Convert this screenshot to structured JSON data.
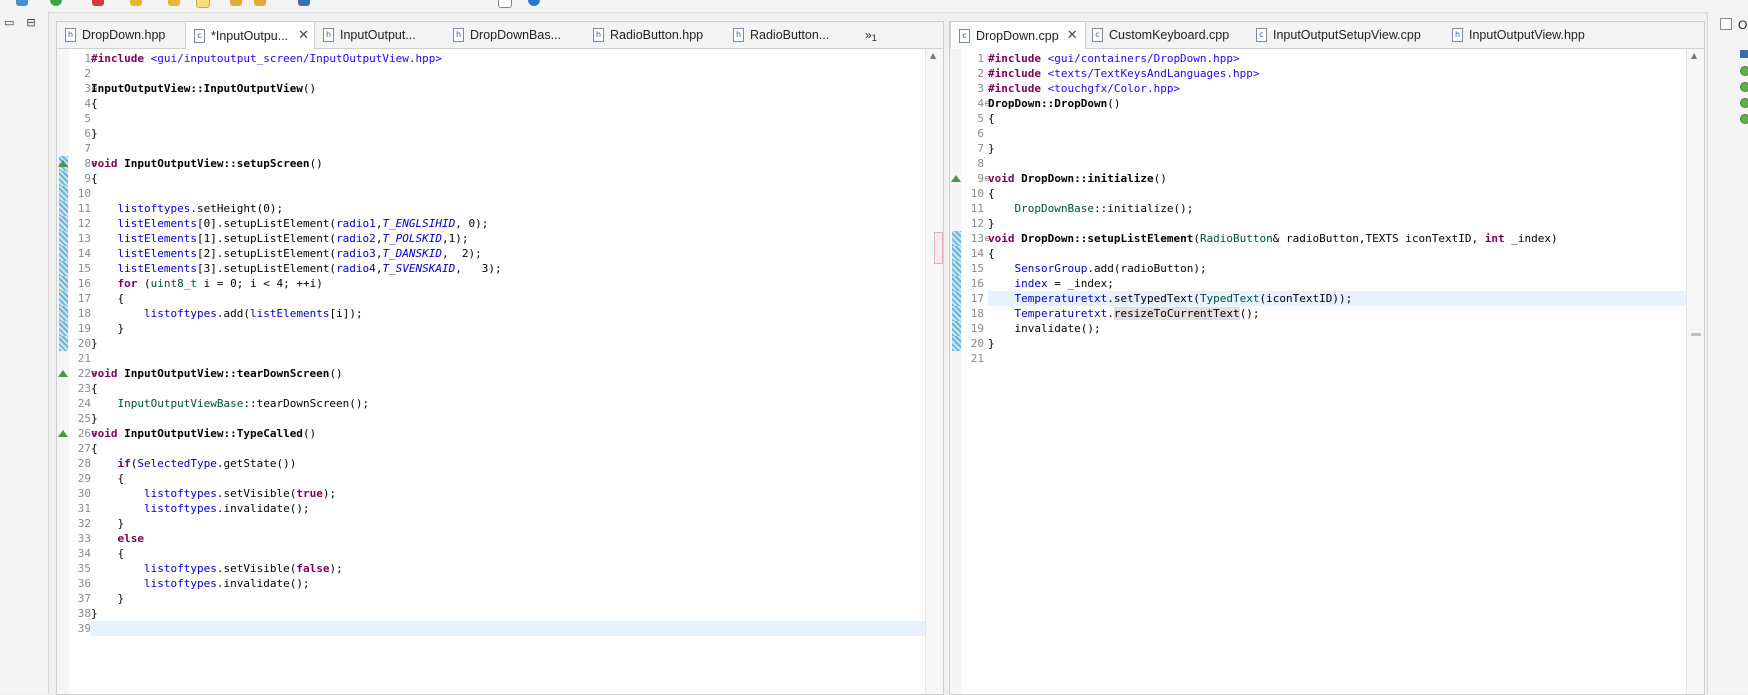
{
  "app": {
    "left_editor": {
      "tabs": [
        {
          "label": "DropDown.hpp",
          "icon": "h",
          "active": false
        },
        {
          "label": "*InputOutpu...",
          "icon": "c",
          "active": true
        },
        {
          "label": "InputOutput...",
          "icon": "h",
          "active": false
        },
        {
          "label": "DropDownBas...",
          "icon": "h",
          "active": false
        },
        {
          "label": "RadioButton.hpp",
          "icon": "h",
          "active": false
        },
        {
          "label": "RadioButton...",
          "icon": "h",
          "active": false
        }
      ],
      "overflow_label": "»",
      "overflow_count": "1",
      "line_numbers": [
        "1",
        "2",
        "3",
        "4",
        "5",
        "6",
        "7",
        "8",
        "9",
        "10",
        "11",
        "12",
        "13",
        "14",
        "15",
        "16",
        "17",
        "18",
        "19",
        "20",
        "21",
        "22",
        "23",
        "24",
        "25",
        "26",
        "27",
        "28",
        "29",
        "30",
        "31",
        "32",
        "33",
        "34",
        "35",
        "36",
        "37",
        "38",
        "39"
      ]
    },
    "right_editor": {
      "tabs": [
        {
          "label": "DropDown.cpp",
          "icon": "c",
          "active": true
        },
        {
          "label": "CustomKeyboard.cpp",
          "icon": "c",
          "active": false
        },
        {
          "label": "InputOutputSetupView.cpp",
          "icon": "c",
          "active": false
        },
        {
          "label": "InputOutputView.hpp",
          "icon": "h",
          "active": false
        }
      ],
      "line_numbers": [
        "1",
        "2",
        "3",
        "4",
        "5",
        "6",
        "7",
        "8",
        "9",
        "10",
        "11",
        "12",
        "13",
        "14",
        "15",
        "16",
        "17",
        "18",
        "19",
        "20",
        "21"
      ]
    },
    "outline_panel": {
      "label": "Ou"
    },
    "icons": {
      "minimize": "minimize-icon",
      "maximize": "maximize-icon",
      "tab_close": "close-icon",
      "file_c": "c-source-file-icon",
      "file_h": "header-file-icon"
    },
    "colors": {
      "keyword": "#7f0055",
      "string": "#2a00ff",
      "field": "#0000c0",
      "type": "#005032",
      "current_line": "#e8f2fe",
      "change_bar": "#6fb4d8"
    }
  }
}
